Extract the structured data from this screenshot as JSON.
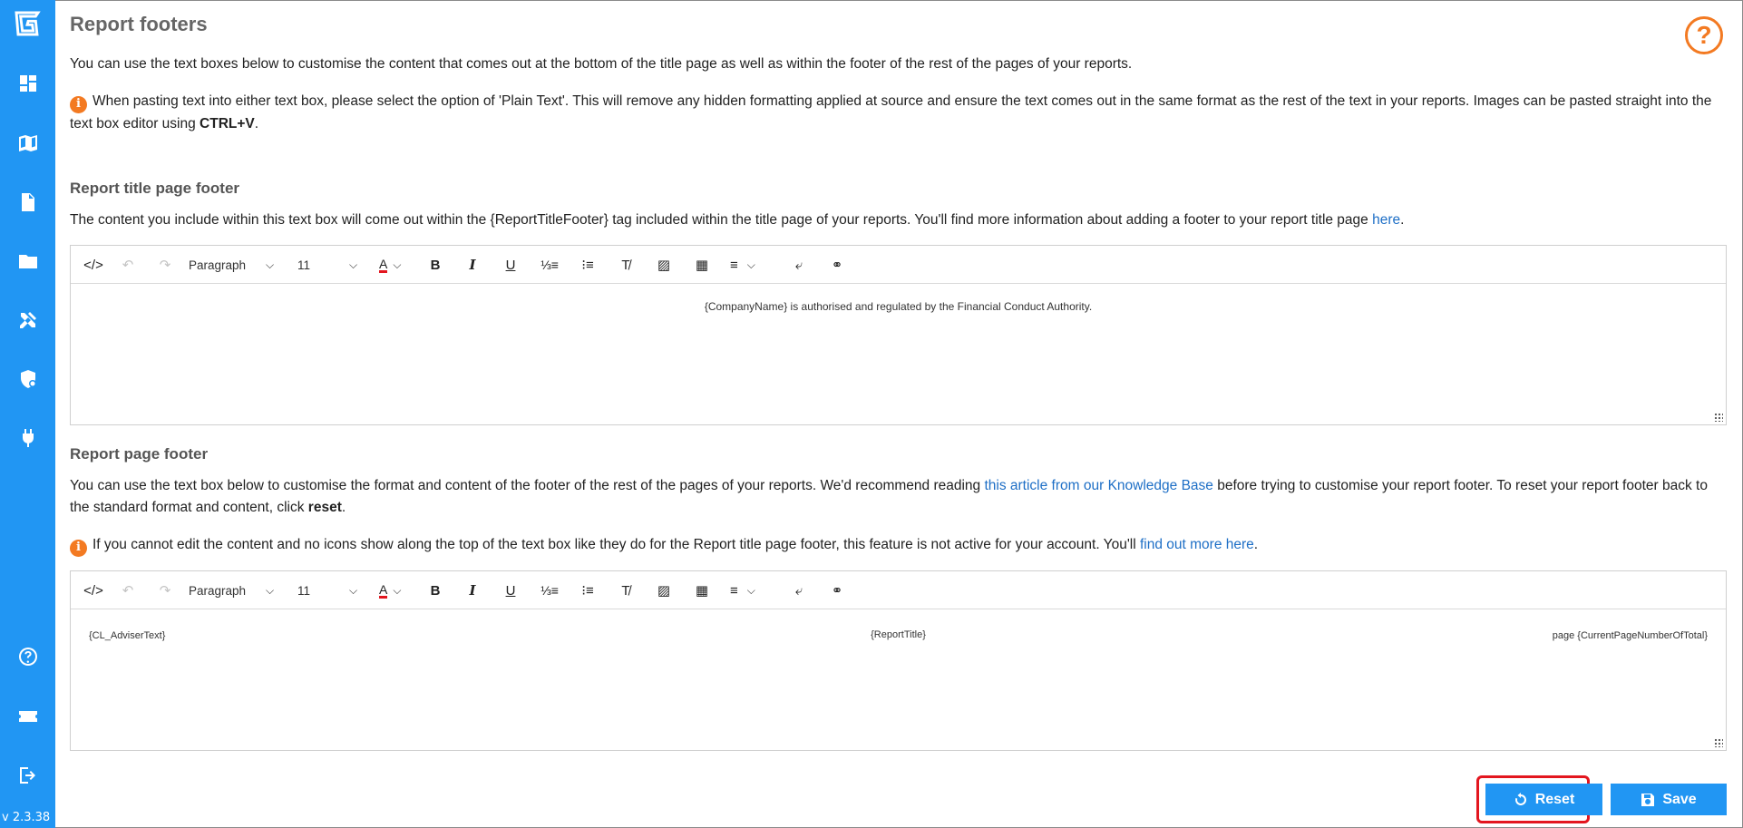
{
  "app": {
    "version": "v 2.3.38"
  },
  "sidebar": {
    "items": [
      {
        "icon": "logo-icon"
      },
      {
        "icon": "dashboard-icon"
      },
      {
        "icon": "book-icon"
      },
      {
        "icon": "document-icon"
      },
      {
        "icon": "folder-icon"
      },
      {
        "icon": "tools-icon"
      },
      {
        "icon": "shield-icon"
      },
      {
        "icon": "plug-icon"
      },
      {
        "icon": "help-icon"
      },
      {
        "icon": "ticket-icon"
      },
      {
        "icon": "logout-icon"
      }
    ]
  },
  "page": {
    "title": "Report footers",
    "intro": "You can use the text boxes below to customise the content that comes out at the bottom of the title page as well as within the footer of the rest of the pages of your reports.",
    "paste_note": "When pasting text into either text box, please select the option of 'Plain Text'. This will remove any hidden formatting applied at source and ensure the text comes out in the same format as the rest of the text in your reports. Images can be pasted straight into the text box editor using",
    "paste_shortcut": "CTRL+V",
    "paste_end": "."
  },
  "title_footer": {
    "heading": "Report title page footer",
    "desc": "The content you include within this text box will come out within the {ReportTitleFooter} tag included within the title page of your reports. You'll find more information about adding a footer to your report title page",
    "link": "here",
    "desc_end": ".",
    "content": "{CompanyName} is authorised and regulated by the Financial Conduct Authority."
  },
  "page_footer": {
    "heading": "Report page footer",
    "desc_start": "You can use the text box below to customise the format and content of the footer of the rest of the pages of your reports. We'd recommend reading",
    "link": "this article from our Knowledge Base",
    "desc_mid": "before trying to customise your report footer. To reset your report footer back to the standard format and content, click",
    "reset_word": "reset",
    "desc_end": ".",
    "note": "If you cannot edit the content and no icons show along the top of the text box like they do for the Report title page footer, this feature is not active for your account. You'll",
    "note_link": "find out more here",
    "note_end": ".",
    "left": "{CL_AdviserText}",
    "center": "{ReportTitle}",
    "right": "page {CurrentPageNumberOfTotal}"
  },
  "toolbar": {
    "block_format": "Paragraph",
    "font_size": "11"
  },
  "buttons": {
    "reset": "Reset",
    "save": "Save"
  },
  "colors": {
    "accent": "#2196f3",
    "warning": "#f37a22",
    "highlight": "#e3161f"
  }
}
